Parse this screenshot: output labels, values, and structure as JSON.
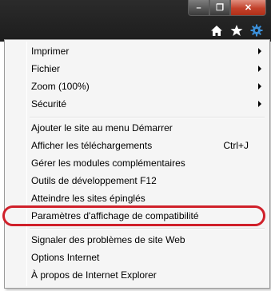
{
  "window": {
    "minimize_glyph": "–",
    "restore_glyph": "❐",
    "close_glyph": "✕"
  },
  "toolbar": {
    "icons": [
      "home-icon",
      "favorites-star-icon",
      "tools-gear-icon"
    ]
  },
  "menu": {
    "group1": [
      {
        "label": "Imprimer",
        "submenu": true
      },
      {
        "label": "Fichier",
        "submenu": true
      },
      {
        "label": "Zoom (100%)",
        "submenu": true
      },
      {
        "label": "Sécurité",
        "submenu": true
      }
    ],
    "group2": [
      {
        "label": "Ajouter le site au menu Démarrer"
      },
      {
        "label": "Afficher les téléchargements",
        "shortcut": "Ctrl+J"
      },
      {
        "label": "Gérer les modules complémentaires"
      },
      {
        "label": "Outils de développement F12"
      },
      {
        "label": "Atteindre les sites épinglés"
      },
      {
        "label": "Paramètres d'affichage de compatibilité",
        "highlighted": true
      }
    ],
    "group3": [
      {
        "label": "Signaler des problèmes de site Web"
      },
      {
        "label": "Options Internet"
      },
      {
        "label": "À propos de Internet Explorer"
      }
    ]
  },
  "colors": {
    "highlight_ring": "#d0202a",
    "chrome_dark": "#1d1d1d",
    "close_button": "#c2412b",
    "gear_blue": "#3b8fd8"
  }
}
